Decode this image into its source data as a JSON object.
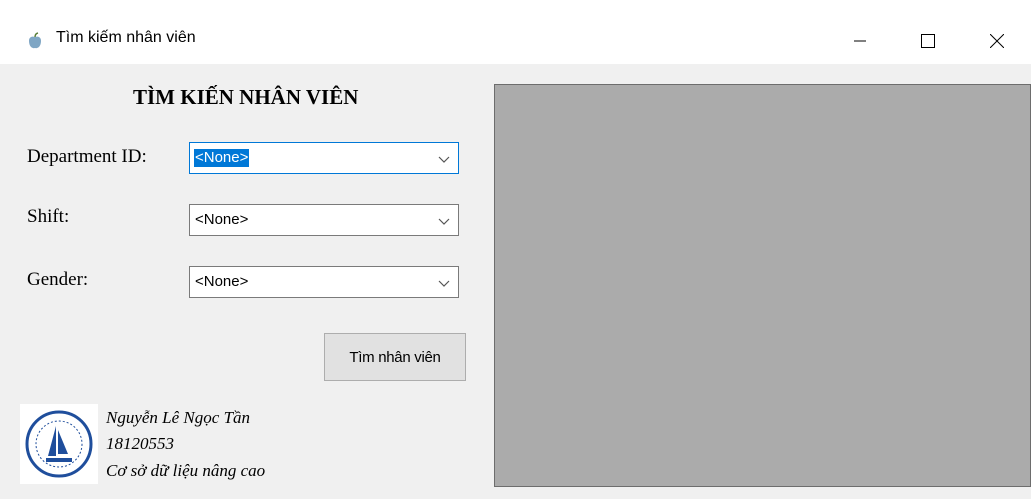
{
  "window": {
    "title": "Tìm kiếm nhân viên",
    "icon": "app-icon",
    "controls": [
      "minimize-icon",
      "maximize-icon",
      "close-icon"
    ]
  },
  "form": {
    "heading": "TÌM KIẾN NHÂN VIÊN",
    "department": {
      "label": "Department ID:",
      "value": "<None>"
    },
    "shift": {
      "label": "Shift:",
      "value": "<None>"
    },
    "gender": {
      "label": "Gender:",
      "value": "<None>"
    },
    "search_button": "Tìm nhân viên"
  },
  "footer": {
    "name": "Nguyễn Lê Ngọc Tần",
    "student_id": "18120553",
    "course": "Cơ sở dữ liệu nâng cao"
  },
  "colors": {
    "selection": "#0078d7",
    "grid_background": "#ababab",
    "form_background": "#f0f0f0"
  }
}
